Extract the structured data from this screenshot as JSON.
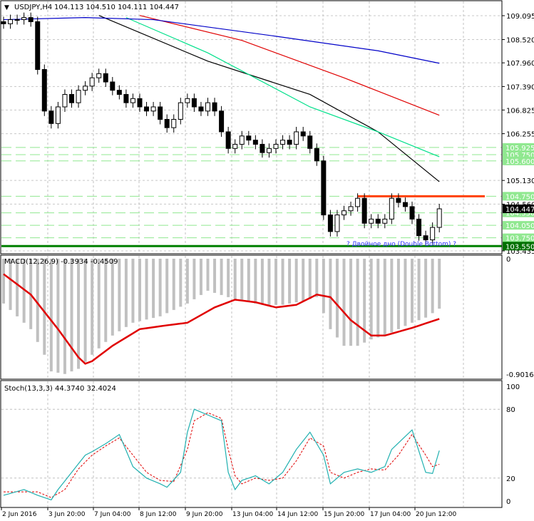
{
  "header": {
    "symbol": "USDJPY,H4",
    "ohlc": "104.113 104.510 104.111 104.447"
  },
  "chart_data": [
    {
      "type": "candlestick",
      "title": "USDJPY,H4",
      "ylim": [
        103.435,
        109.095
      ],
      "closes": [
        108.9,
        109.0,
        109.0,
        109.05,
        108.95,
        107.8,
        106.8,
        106.5,
        106.9,
        107.2,
        107.0,
        107.3,
        107.4,
        107.6,
        107.7,
        107.5,
        107.3,
        107.2,
        107.0,
        107.1,
        106.9,
        106.8,
        106.9,
        106.6,
        106.4,
        106.6,
        107.0,
        107.1,
        106.9,
        106.8,
        107.0,
        106.8,
        106.3,
        105.9,
        106.0,
        106.2,
        106.1,
        106.0,
        105.8,
        105.9,
        106.0,
        106.1,
        106.0,
        106.3,
        106.2,
        105.9,
        105.6,
        104.3,
        103.9,
        104.3,
        104.4,
        104.5,
        104.7,
        104.1,
        104.2,
        104.1,
        104.2,
        104.7,
        104.6,
        104.5,
        104.2,
        103.8,
        103.7,
        104.0,
        104.447
      ],
      "moving_averages": [
        {
          "color": "#000000",
          "points": [
            [
              14,
              109.1
            ],
            [
              30,
              108.0
            ],
            [
              45,
              107.2
            ],
            [
              55,
              106.3
            ],
            [
              64,
              105.1
            ]
          ]
        },
        {
          "color": "#00e08a",
          "points": [
            [
              18,
              109.05
            ],
            [
              30,
              108.2
            ],
            [
              45,
              106.9
            ],
            [
              55,
              106.3
            ],
            [
              64,
              105.7
            ]
          ]
        },
        {
          "color": "#e00000",
          "points": [
            [
              20,
              109.1
            ],
            [
              35,
              108.5
            ],
            [
              50,
              107.6
            ],
            [
              64,
              106.7
            ]
          ]
        },
        {
          "color": "#0000c8",
          "points": [
            [
              0,
              109.0
            ],
            [
              12,
              109.05
            ],
            [
              22,
              109.0
            ],
            [
              40,
              108.6
            ],
            [
              55,
              108.25
            ],
            [
              64,
              107.95
            ]
          ]
        }
      ],
      "levels": [
        {
          "label": "105.925",
          "value": 105.925,
          "style": "dashed"
        },
        {
          "label": "105.750",
          "value": 105.75,
          "style": "dashed"
        },
        {
          "label": "105.600",
          "value": 105.6,
          "style": "dashed"
        },
        {
          "label": "104.750",
          "value": 104.75,
          "style": "dashed"
        },
        {
          "label": "104.350",
          "value": 104.35,
          "style": "dashed"
        },
        {
          "label": "104.050",
          "value": 104.05,
          "style": "dashed"
        },
        {
          "label": "103.750",
          "value": 103.75,
          "style": "dashed"
        },
        {
          "label": "103.550",
          "value": 103.55,
          "style": "solid"
        }
      ],
      "resistance_line": {
        "value": 104.75,
        "from_bar": 52,
        "color": "#ff4000"
      },
      "annotation": "? Двойное дно (Double Bottom) ?",
      "current_price": "104.447",
      "price_ticks": [
        "109.095",
        "108.520",
        "107.960",
        "107.390",
        "106.825",
        "106.255",
        "105.130",
        "104.560",
        "103.435"
      ],
      "time_ticks": [
        "2 Jun 2016",
        "3 Jun 20:00",
        "7 Jun 04:00",
        "8 Jun 12:00",
        "9 Jun 20:00",
        "13 Jun 04:00",
        "14 Jun 12:00",
        "15 Jun 20:00",
        "17 Jun 04:00",
        "20 Jun 12:00"
      ]
    },
    {
      "type": "bar",
      "title": "MACD(12,26,9) -0.3934 -0.4509",
      "ylim": [
        -0.9016,
        0
      ],
      "tick_labels": [
        "0",
        "-0.9016"
      ],
      "histogram_keypoints": [
        [
          0,
          -0.35
        ],
        [
          2,
          -0.45
        ],
        [
          4,
          -0.55
        ],
        [
          6,
          -0.75
        ],
        [
          7,
          -0.88
        ],
        [
          9,
          -0.9
        ],
        [
          11,
          -0.86
        ],
        [
          13,
          -0.75
        ],
        [
          16,
          -0.6
        ],
        [
          19,
          -0.5
        ],
        [
          23,
          -0.45
        ],
        [
          27,
          -0.35
        ],
        [
          30,
          -0.25
        ],
        [
          33,
          -0.3
        ],
        [
          35,
          -0.33
        ],
        [
          38,
          -0.36
        ],
        [
          41,
          -0.36
        ],
        [
          44,
          -0.33
        ],
        [
          46,
          -0.3
        ],
        [
          48,
          -0.55
        ],
        [
          50,
          -0.68
        ],
        [
          52,
          -0.68
        ],
        [
          54,
          -0.63
        ],
        [
          56,
          -0.6
        ],
        [
          58,
          -0.55
        ],
        [
          60,
          -0.5
        ],
        [
          62,
          -0.46
        ],
        [
          64,
          -0.39
        ]
      ],
      "signal_keypoints": [
        [
          0,
          -0.12
        ],
        [
          4,
          -0.28
        ],
        [
          8,
          -0.55
        ],
        [
          11,
          -0.77
        ],
        [
          12,
          -0.82
        ],
        [
          13,
          -0.8
        ],
        [
          16,
          -0.68
        ],
        [
          20,
          -0.55
        ],
        [
          24,
          -0.52
        ],
        [
          27,
          -0.5
        ],
        [
          31,
          -0.38
        ],
        [
          34,
          -0.32
        ],
        [
          37,
          -0.34
        ],
        [
          40,
          -0.38
        ],
        [
          43,
          -0.36
        ],
        [
          46,
          -0.28
        ],
        [
          48,
          -0.3
        ],
        [
          51,
          -0.48
        ],
        [
          54,
          -0.6
        ],
        [
          56,
          -0.6
        ],
        [
          60,
          -0.54
        ],
        [
          64,
          -0.47
        ]
      ]
    },
    {
      "type": "line",
      "title": "Stoch(13,3,3) 44.3740 32.4024",
      "ylim": [
        0,
        100
      ],
      "tick_labels": [
        "100",
        "80",
        "20",
        "0"
      ],
      "k_keypoints": [
        [
          0,
          5
        ],
        [
          3,
          10
        ],
        [
          5,
          5
        ],
        [
          7,
          1
        ],
        [
          8,
          10
        ],
        [
          10,
          25
        ],
        [
          12,
          40
        ],
        [
          13,
          43
        ],
        [
          15,
          50
        ],
        [
          17,
          58
        ],
        [
          19,
          30
        ],
        [
          21,
          20
        ],
        [
          23,
          15
        ],
        [
          24,
          12
        ],
        [
          26,
          25
        ],
        [
          27,
          60
        ],
        [
          28,
          80
        ],
        [
          30,
          75
        ],
        [
          32,
          70
        ],
        [
          33,
          25
        ],
        [
          34,
          10
        ],
        [
          35,
          18
        ],
        [
          37,
          22
        ],
        [
          39,
          15
        ],
        [
          41,
          25
        ],
        [
          43,
          45
        ],
        [
          45,
          60
        ],
        [
          47,
          40
        ],
        [
          48,
          15
        ],
        [
          50,
          25
        ],
        [
          52,
          28
        ],
        [
          54,
          25
        ],
        [
          56,
          30
        ],
        [
          57,
          45
        ],
        [
          60,
          62
        ],
        [
          62,
          25
        ],
        [
          63,
          24
        ],
        [
          64,
          44
        ]
      ],
      "d_keypoints": [
        [
          0,
          8
        ],
        [
          3,
          8
        ],
        [
          5,
          8
        ],
        [
          7,
          3
        ],
        [
          9,
          10
        ],
        [
          11,
          28
        ],
        [
          13,
          40
        ],
        [
          15,
          48
        ],
        [
          17,
          55
        ],
        [
          19,
          40
        ],
        [
          21,
          25
        ],
        [
          23,
          18
        ],
        [
          25,
          17
        ],
        [
          27,
          45
        ],
        [
          28,
          70
        ],
        [
          30,
          77
        ],
        [
          32,
          72
        ],
        [
          33,
          45
        ],
        [
          34,
          22
        ],
        [
          35,
          15
        ],
        [
          37,
          20
        ],
        [
          39,
          18
        ],
        [
          41,
          20
        ],
        [
          43,
          35
        ],
        [
          45,
          55
        ],
        [
          47,
          48
        ],
        [
          48,
          25
        ],
        [
          50,
          20
        ],
        [
          52,
          25
        ],
        [
          54,
          28
        ],
        [
          56,
          27
        ],
        [
          58,
          40
        ],
        [
          60,
          58
        ],
        [
          62,
          40
        ],
        [
          63,
          30
        ],
        [
          64,
          32
        ]
      ]
    }
  ]
}
